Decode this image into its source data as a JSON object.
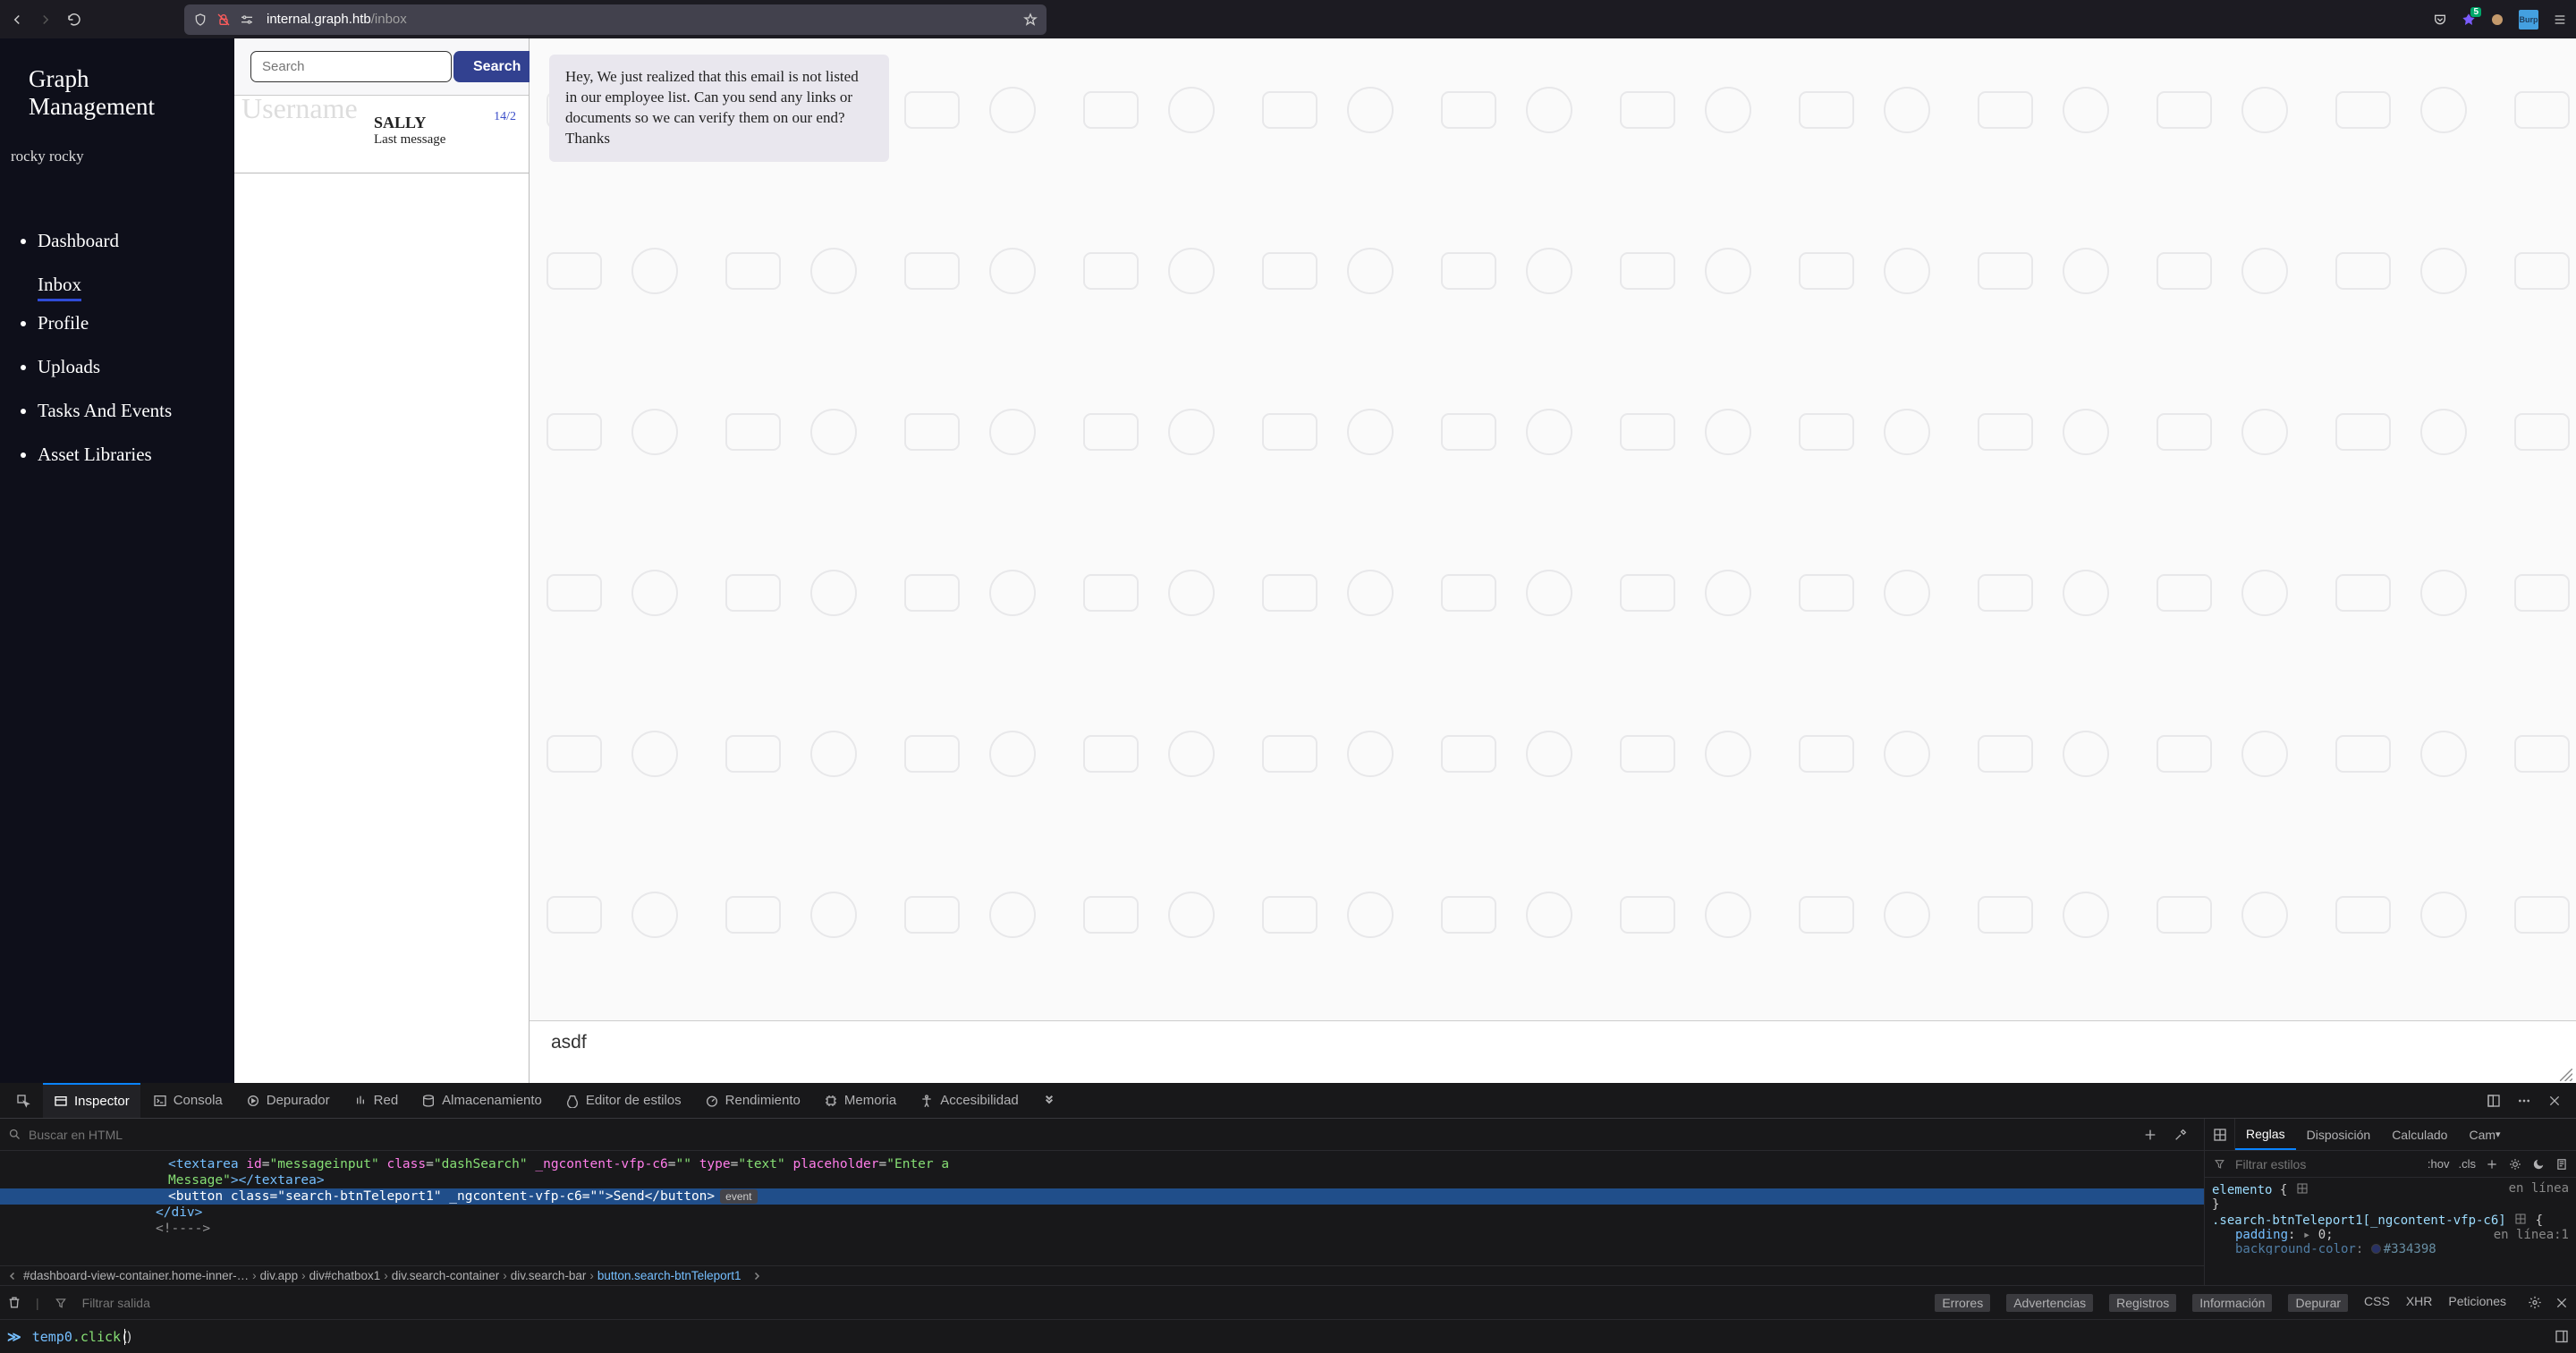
{
  "browser": {
    "url_host": "internal.graph.htb",
    "url_path": "/inbox",
    "ext_badge": "5",
    "burp": "Burp"
  },
  "sidebar": {
    "brand": "Graph Management",
    "user": "rocky rocky",
    "items": [
      {
        "label": "Dashboard"
      },
      {
        "label": "Inbox"
      },
      {
        "label": "Profile"
      },
      {
        "label": "Uploads"
      },
      {
        "label": "Tasks And Events"
      },
      {
        "label": "Asset Libraries"
      }
    ]
  },
  "inbox": {
    "watermark": "Username",
    "search_placeholder": "Search",
    "search_button": "Search",
    "thread": {
      "name": "SALLY",
      "last": "Last message",
      "date": "14/2"
    }
  },
  "chat": {
    "message": "Hey, We just realized that this email is not listed in our employee list. Can you send any links or documents so we can verify them on our end? Thanks",
    "compose_value": "asdf",
    "compose_placeholder": "Enter a Message"
  },
  "devtools": {
    "tabs": {
      "inspector": "Inspector",
      "console": "Consola",
      "debugger": "Depurador",
      "network": "Red",
      "storage": "Almacenamiento",
      "style": "Editor de estilos",
      "perf": "Rendimiento",
      "memory": "Memoria",
      "a11y": "Accesibilidad"
    },
    "search_placeholder": "Buscar en HTML",
    "dom": {
      "l1_tag_open": "<",
      "l1_tag": "textarea",
      "l1_attrs": " id=\"messageinput\" class=\"dashSearch\" _ngcontent-vfp-c6=\"\" type=\"text\" placeholder=\"Enter a Message\">",
      "l1_close": "</textarea>",
      "l2_tag_open": "<",
      "l2_tag": "button",
      "l2_attrs": " class=\"search-btnTeleport1\" _ngcontent-vfp-c6=\"\">",
      "l2_text": "Send",
      "l2_close": "</button>",
      "l2_badge": "event",
      "l3": "</div>",
      "l4": "<!---->"
    },
    "crumbs": [
      "…",
      "#dashboard-view-container.home-inner-…",
      "div.app",
      "div#chatbox1",
      "div.search-container",
      "div.search-bar",
      "button.search-btnTeleport1"
    ],
    "side": {
      "tabs": {
        "rules": "Reglas",
        "layout": "Disposición",
        "computed": "Calculado",
        "changes": "Cam"
      },
      "filter_placeholder": "Filtrar estilos",
      "hov": ":hov",
      "cls": ".cls",
      "rules": {
        "inline_sel": "elemento ",
        "inline_loc": "en línea",
        "class_sel": ".search-btnTeleport1[_ngcontent-vfp-c6] ",
        "class_loc": "en línea:1",
        "prop1": "padding",
        "val1": "0",
        "hash": "#334398"
      }
    },
    "consolebar": {
      "filter_placeholder": "Filtrar salida",
      "filters": [
        "Errores",
        "Advertencias",
        "Registros",
        "Información",
        "Depurar"
      ],
      "net": [
        "CSS",
        "XHR",
        "Peticiones"
      ]
    },
    "console_input": {
      "var": "temp0",
      "fn": ".click",
      "paren": "()"
    }
  }
}
